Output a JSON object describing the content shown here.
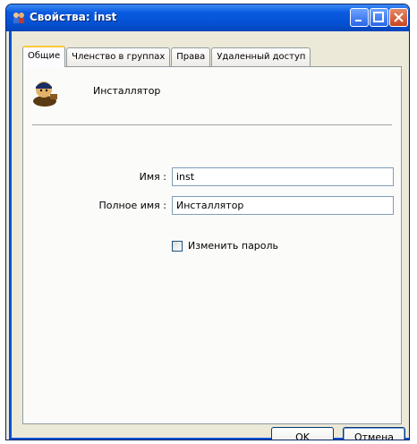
{
  "window": {
    "title": "Свойства: inst"
  },
  "tabs": [
    {
      "label": "Общие",
      "active": true
    },
    {
      "label": "Членство в группах",
      "active": false
    },
    {
      "label": "Права",
      "active": false
    },
    {
      "label": "Удаленный доступ",
      "active": false
    }
  ],
  "general": {
    "display_name": "Инсталлятор",
    "name_label": "Имя :",
    "name_value": "inst",
    "full_name_label": "Полное имя :",
    "full_name_value": "Инсталлятор",
    "change_password_label": "Изменить пароль",
    "change_password_checked": false
  },
  "buttons": {
    "ok": "OK",
    "cancel": "Отмена"
  },
  "colors": {
    "titlebar": "#0551d3",
    "face": "#ece9d8",
    "tab_highlight": "#ffc73c"
  }
}
